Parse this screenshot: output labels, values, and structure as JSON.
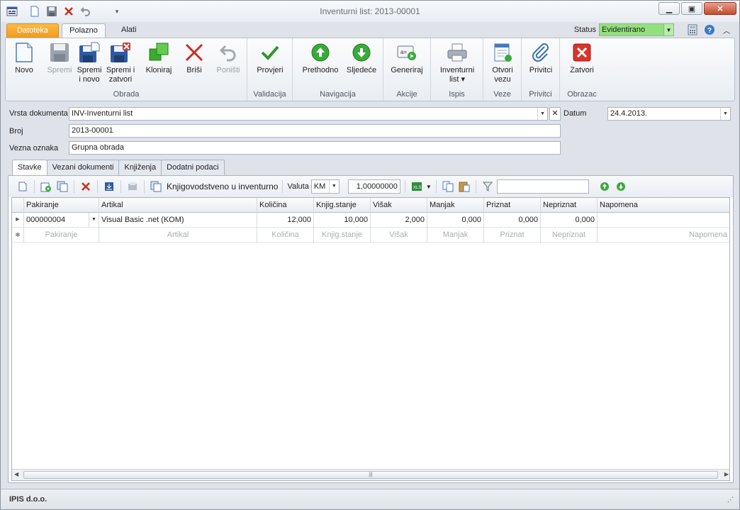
{
  "window": {
    "title": "Inventurni list: 2013-00001"
  },
  "ribbon_tabs": {
    "file": "Datoteka",
    "home": "Polazno",
    "tools": "Alati"
  },
  "status": {
    "label": "Status",
    "value": "Evidentirano"
  },
  "ribbon": {
    "groups": {
      "obrada": "Obrada",
      "validacija": "Validacija",
      "navigacija": "Navigacija",
      "akcije": "Akcije",
      "ispis": "Ispis",
      "veze": "Veze",
      "privitci": "Privitci",
      "obrazac": "Obrazac"
    },
    "buttons": {
      "novo": "Novo",
      "spremi": "Spremi",
      "spremi_novo_1": "Spremi",
      "spremi_novo_2": "i novo",
      "spremi_zatvori_1": "Spremi i",
      "spremi_zatvori_2": "zatvori",
      "kloniraj": "Kloniraj",
      "brisi": "Briši",
      "ponisti": "Poništi",
      "provjeri": "Provjeri",
      "prethodno": "Prethodno",
      "sljedece": "Sljedeće",
      "generiraj": "Generiraj",
      "inventurni_1": "Inventurni",
      "inventurni_2": "list ▾",
      "otvori_1": "Otvori",
      "otvori_2": "vezu",
      "privitci": "Privitci",
      "zatvori": "Zatvori"
    }
  },
  "form": {
    "vrsta_label": "Vrsta dokumenta",
    "vrsta_value": "INV-Inventurni list",
    "broj_label": "Broj",
    "broj_value": "2013-00001",
    "vezna_label": "Vezna oznaka",
    "vezna_value": "Grupna obrada",
    "datum_label": "Datum",
    "datum_value": "24.4.2013."
  },
  "subtabs": [
    "Stavke",
    "Vezani dokumenti",
    "Knjiženja",
    "Dodatni podaci"
  ],
  "toolbar": {
    "knjig_label": "Knjigovodstveno u inventurno",
    "valuta_label": "Valuta",
    "valuta_value": "KM",
    "rate_value": "1,00000000"
  },
  "grid": {
    "columns": [
      "Pakiranje",
      "Artikal",
      "Količina",
      "Knjig.stanje",
      "Višak",
      "Manjak",
      "Priznat",
      "Nepriznat",
      "Napomena"
    ],
    "rows": [
      [
        "000000004",
        "Visual Basic .net (KOM)",
        "12,000",
        "10,000",
        "2,000",
        "0,000",
        "0,000",
        "0,000",
        ""
      ]
    ],
    "new_row": [
      "Pakiranje",
      "Artikal",
      "Količina",
      "Knjig.stanje",
      "Višak",
      "Manjak",
      "Priznat",
      "Nepriznat",
      "Napomena"
    ]
  },
  "statusbar": {
    "company": "IPIS d.o.o."
  }
}
